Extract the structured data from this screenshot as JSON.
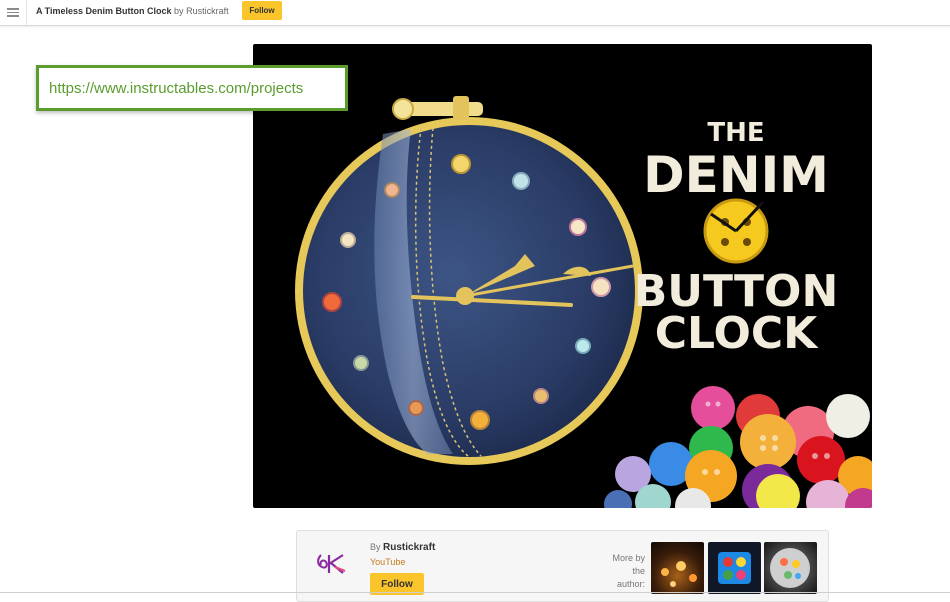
{
  "header": {
    "menu_icon": "hamburger-menu-icon",
    "project_title": "A Timeless Denim Button Clock",
    "by_text": "by",
    "author": "Rustickraft",
    "follow_label": "Follow"
  },
  "hero": {
    "title_line1": "THE",
    "title_line2": "DENIM",
    "title_line3": "BUTTON",
    "title_line4": "CLOCK"
  },
  "url_overlay": {
    "url": "https://www.instructables.com/projects"
  },
  "author_card": {
    "by_label": "By",
    "author": "Rustickraft",
    "channel_link": "YouTube",
    "follow_label": "Follow",
    "more_by_label": "More by the author:"
  },
  "colors": {
    "accent_yellow": "#fac42b",
    "url_green": "#5b9c2f",
    "denim_blue": "#2b3d66",
    "hoop_gold": "#e7c95a"
  }
}
